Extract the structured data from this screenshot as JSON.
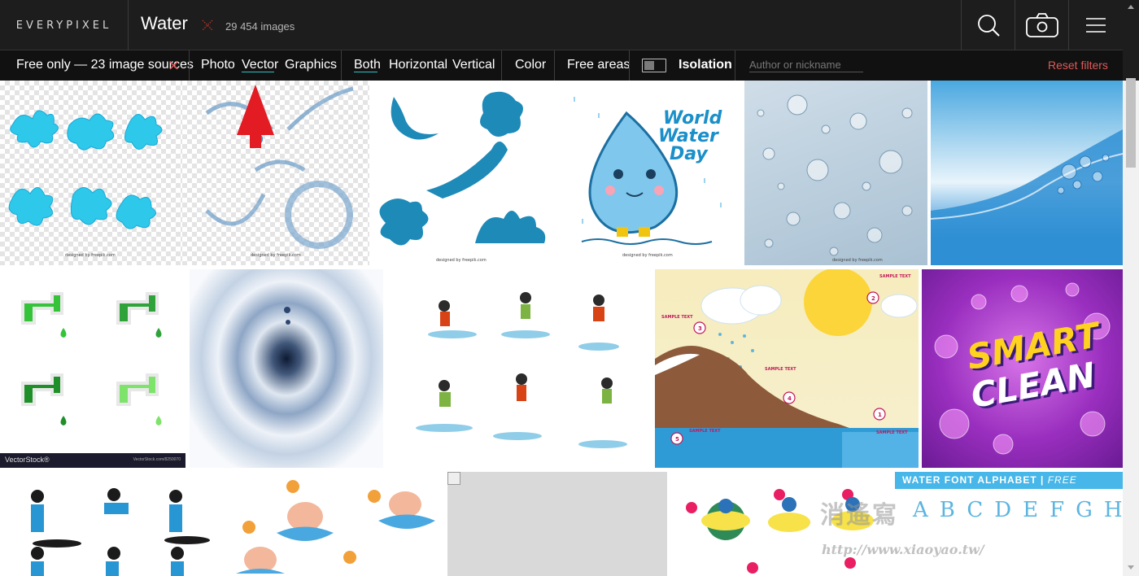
{
  "header": {
    "logo_text": "EVERYPIXEL",
    "query": "Water",
    "result_count": "29 454 images",
    "icons": [
      "search-icon",
      "camera-icon",
      "menu-icon",
      "clear-query-icon"
    ]
  },
  "filters": {
    "sources": "Free only — 23 image sources",
    "types": [
      "Photo",
      "Vector",
      "Graphics"
    ],
    "active_type": "Vector",
    "orientations": [
      "Both",
      "Horizontal",
      "Vertical"
    ],
    "active_orientation": "Both",
    "color": "Color",
    "free_areas": "Free areas",
    "isolation": "Isolation",
    "author_placeholder": "Author or nickname",
    "reset": "Reset filters"
  },
  "colors": {
    "header_bg": "#1d1d1d",
    "filter_bg": "#111111",
    "accent": "#2bc2c9",
    "reset": "#e05a5a",
    "annotation_arrow": "#e31b23"
  },
  "results": {
    "row1": [
      {
        "credit": "designed by freepik.com"
      },
      {
        "credit": "designed by freepik.com"
      },
      {
        "credit": "designed by freepik.com"
      },
      {
        "title": [
          "World",
          "Water",
          "Day"
        ],
        "credit": "designed by freepik.com"
      },
      {
        "credit": "designed by freepik.com"
      },
      {}
    ],
    "row2": [
      {
        "brand": "VectorStock®",
        "credit": "VectorStock.com/8250070"
      },
      {},
      {},
      {
        "labels": [
          "SAMPLE TEXT",
          "SAMPLE TEXT",
          "SAMPLE TEXT",
          "SAMPLE TEXT",
          "SAMPLE TEXT"
        ],
        "steps": [
          "1",
          "2",
          "3",
          "4",
          "5"
        ]
      },
      {
        "title": [
          "SMART",
          "CLEAN"
        ]
      }
    ],
    "row3": [
      {},
      {},
      {},
      {},
      {
        "title": "WATER FONT ALPHABET",
        "subtitle": "FREE VECTOR",
        "letters": "ABCDEFGHIJKLMNO"
      }
    ]
  },
  "watermark": {
    "text": "消遙寫",
    "url": "http://www.xiaoyao.tw/"
  }
}
